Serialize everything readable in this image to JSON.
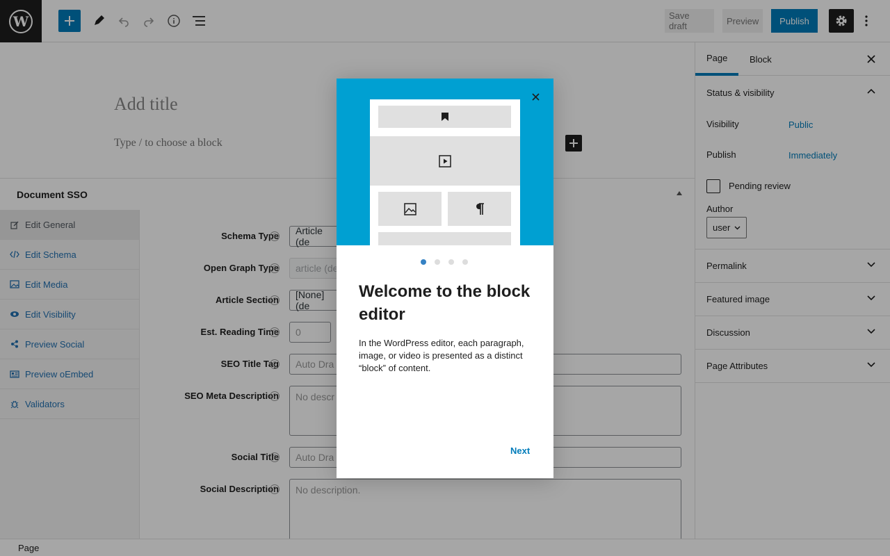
{
  "toolbar": {
    "save_draft": "Save draft",
    "preview": "Preview",
    "publish": "Publish"
  },
  "editor": {
    "title_placeholder": "Add title",
    "block_placeholder": "Type / to choose a block"
  },
  "metabox": {
    "title": "Document SSO",
    "tabs": [
      {
        "label": "Edit General",
        "icon": "edit-icon"
      },
      {
        "label": "Edit Schema",
        "icon": "code-icon"
      },
      {
        "label": "Edit Media",
        "icon": "image-icon"
      },
      {
        "label": "Edit Visibility",
        "icon": "eye-icon"
      },
      {
        "label": "Preview Social",
        "icon": "share-icon"
      },
      {
        "label": "Preview oEmbed",
        "icon": "card-icon"
      },
      {
        "label": "Validators",
        "icon": "bug-icon"
      }
    ],
    "fields": [
      {
        "label": "Schema Type",
        "value": "Article (de"
      },
      {
        "label": "Open Graph Type",
        "value": "article (de"
      },
      {
        "label": "Article Section",
        "value": "[None] (de"
      },
      {
        "label": "Est. Reading Time",
        "value": "0"
      },
      {
        "label": "SEO Title Tag",
        "value": "Auto Dra"
      },
      {
        "label": "SEO Meta Description",
        "value": "No descr"
      },
      {
        "label": "Social Title",
        "value": "Auto Dra"
      },
      {
        "label": "Social Description",
        "value": "No description."
      }
    ]
  },
  "sidebar": {
    "tabs": [
      "Page",
      "Block"
    ],
    "status_title": "Status & visibility",
    "visibility_label": "Visibility",
    "visibility_value": "Public",
    "publish_label": "Publish",
    "publish_value": "Immediately",
    "pending_label": "Pending review",
    "author_label": "Author",
    "author_value": "user",
    "panels": [
      "Permalink",
      "Featured image",
      "Discussion",
      "Page Attributes"
    ]
  },
  "statusbar": {
    "label": "Page"
  },
  "modal": {
    "heading": "Welcome to the block editor",
    "body": "In the WordPress editor, each paragraph, image, or video is presented as a distinct “block” of content.",
    "next": "Next",
    "page_count": 4,
    "current_page": 1
  },
  "colors": {
    "accent": "#007cba",
    "hero": "#00a0d2",
    "link": "#2271b1"
  }
}
